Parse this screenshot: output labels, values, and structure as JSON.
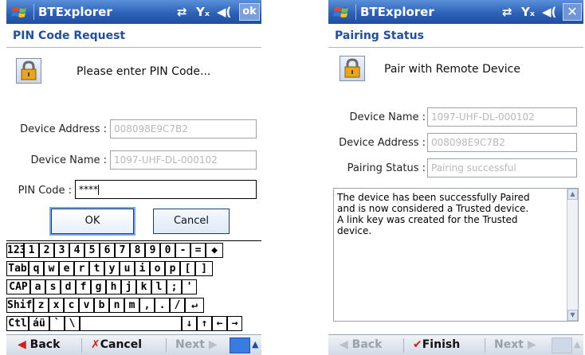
{
  "left": {
    "title": "BTExplorer",
    "ok_label": "ok",
    "header": "PIN Code Request",
    "message": "Please enter PIN Code...",
    "device_address_label": "Device Address :",
    "device_address_value": "008098E9C7B2",
    "device_name_label": "Device Name :",
    "device_name_value": "1097-UHF-DL-000102",
    "pin_label": "PIN Code :",
    "pin_value": "****",
    "ok_button": "OK",
    "cancel_button": "Cancel",
    "keyboard": [
      [
        "123",
        "1",
        "2",
        "3",
        "4",
        "5",
        "6",
        "7",
        "8",
        "9",
        "0",
        "-",
        "=",
        "◆"
      ],
      [
        "Tab",
        "q",
        "w",
        "e",
        "r",
        "t",
        "y",
        "u",
        "i",
        "o",
        "p",
        "[",
        "]"
      ],
      [
        "CAP",
        "a",
        "s",
        "d",
        "f",
        "g",
        "h",
        "j",
        "k",
        "l",
        ";",
        "'"
      ],
      [
        "Shift",
        "z",
        "x",
        "c",
        "v",
        "b",
        "n",
        "m",
        ",",
        ".",
        "/",
        "↵"
      ],
      [
        "Ctl",
        "áü",
        "`",
        "\\",
        "",
        "↓",
        "↑",
        "←",
        "→"
      ]
    ],
    "menu_back": "Back",
    "menu_cancel": "Cancel",
    "menu_next": "Next"
  },
  "right": {
    "title": "BTExplorer",
    "close_label": "✕",
    "header": "Pairing Status",
    "message": "Pair with Remote Device",
    "device_name_label": "Device Name :",
    "device_name_value": "1097-UHF-DL-000102",
    "device_address_label": "Device Address :",
    "device_address_value": "008098E9C7B2",
    "pairing_status_label": "Pairing Status :",
    "pairing_status_value": "Pairing successful",
    "details_lines": [
      "The device has been successfully Paired",
      "and is now considered a Trusted device.",
      "A link key was created for the Trusted",
      "device."
    ],
    "menu_back": "Back",
    "menu_finish": "Finish",
    "menu_next": "Next"
  },
  "icons": {
    "windows_logo": "windows-flag-icon",
    "connectivity": "⇄",
    "signal": "Yₓ",
    "volume": "◀("
  },
  "colors": {
    "titlebar": "#2d62b8",
    "header_text": "#1f4f9e",
    "finish_check": "#d0201b",
    "cancel_x": "#d0201b",
    "nav_arrow": "#d0201b"
  }
}
